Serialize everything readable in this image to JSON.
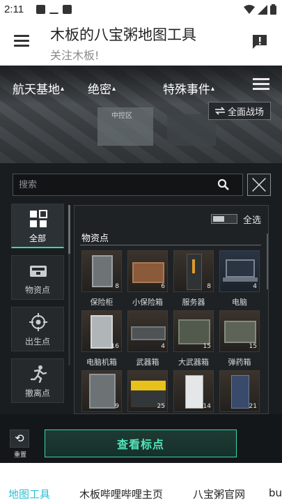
{
  "status": {
    "time": "2:11",
    "icons": [
      "image-icon",
      "download-icon",
      "a-box-icon"
    ],
    "right_icons": [
      "wifi-icon",
      "signal-icon",
      "battery-icon"
    ]
  },
  "header": {
    "title": "木板的八宝粥地图工具",
    "subtitle": "关注木板!",
    "menu_icon": "hamburger-menu-icon",
    "report_icon": "feedback-alert-icon"
  },
  "map": {
    "filters": [
      "航天基地",
      "绝密",
      "特殊事件"
    ],
    "caret": "▴",
    "map_label": "中控区",
    "battle_button": "全面战场",
    "search_placeholder": "搜索"
  },
  "categories": [
    {
      "label": "全部",
      "icon": "grid-icon",
      "active": true
    },
    {
      "label": "物资点",
      "icon": "crate-icon",
      "active": false
    },
    {
      "label": "出生点",
      "icon": "target-icon",
      "active": false
    },
    {
      "label": "撤离点",
      "icon": "running-man-icon",
      "active": false
    }
  ],
  "panel": {
    "select_all": "全选",
    "section_title": "物资点",
    "items": [
      {
        "name": "保险柜",
        "count": "8"
      },
      {
        "name": "小保险箱",
        "count": "6"
      },
      {
        "name": "服务器",
        "count": "8"
      },
      {
        "name": "电脑",
        "count": "4"
      },
      {
        "name": "电脑机箱",
        "count": "16"
      },
      {
        "name": "武器箱",
        "count": "4"
      },
      {
        "name": "大武器箱",
        "count": "15"
      },
      {
        "name": "弹药箱",
        "count": "15"
      },
      {
        "name": "",
        "count": "9"
      },
      {
        "name": "",
        "count": "25"
      },
      {
        "name": "",
        "count": "14"
      },
      {
        "name": "",
        "count": "21"
      }
    ]
  },
  "controls": {
    "reset_label": "重置",
    "view_button": "查看标点"
  },
  "bottom_nav": {
    "items": [
      "地图工具",
      "木板哔哩哔哩主页",
      "八宝粥官网",
      "bu"
    ]
  },
  "colors": {
    "accent_green": "#3ad8ac",
    "nav_active": "#2bbfd6",
    "dark_bg": "#1a1d1f"
  }
}
